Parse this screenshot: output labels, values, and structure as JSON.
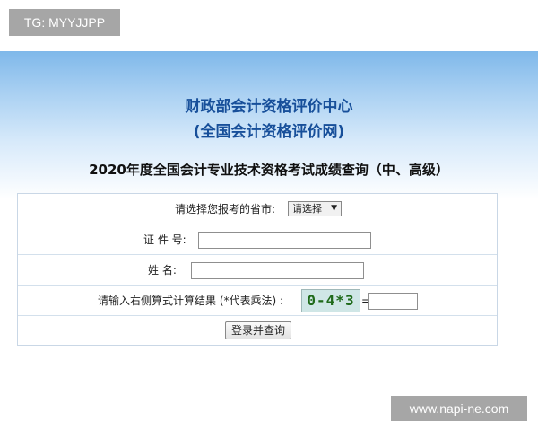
{
  "badge": {
    "text": "TG: MYYJJPP"
  },
  "header": {
    "org_name": "财政部会计资格评价中心",
    "org_subname": "(全国会计资格评价网)"
  },
  "page_title": "2020年度全国会计专业技术资格考试成绩查询（中、高级）",
  "form": {
    "province_label": "请选择您报考的省市:",
    "province_select": {
      "selected": "请选择"
    },
    "id_label": "证 件 号:",
    "id_value": "",
    "name_label": "姓  名:",
    "name_value": "",
    "captcha_label": "请输入右侧算式计算结果 (*代表乘法) :",
    "captcha_text": "0-4*3",
    "equals": "=",
    "captcha_value": "",
    "submit_label": "登录并查询"
  },
  "watermark": {
    "text": "www.napi-ne.com"
  },
  "colors": {
    "title_blue": "#174f9a",
    "header_gradient_top": "#7fb8ea",
    "table_border": "#c9d7e6"
  }
}
